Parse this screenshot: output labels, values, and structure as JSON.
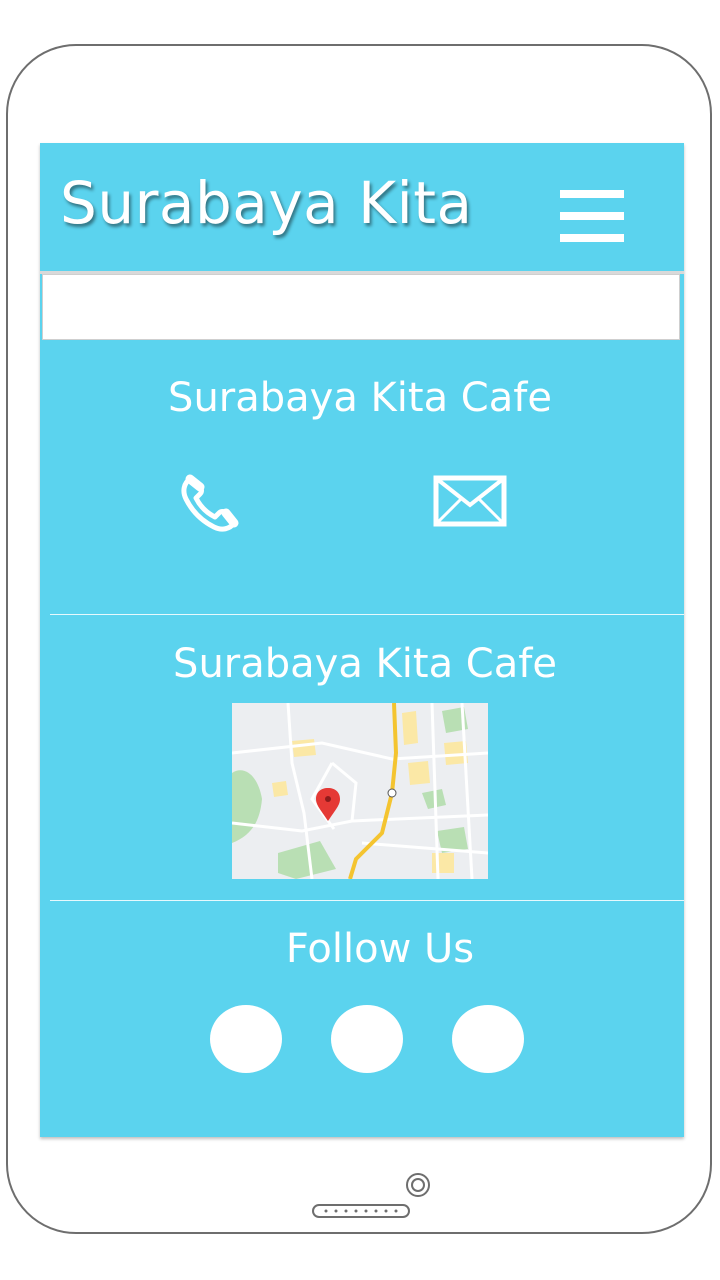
{
  "app": {
    "title": "Surabaya Kita"
  },
  "header": {
    "menu_icon": "hamburger-menu-icon"
  },
  "search": {
    "value": ""
  },
  "contact": {
    "title": "Surabaya Kita Cafe",
    "phone_icon": "phone-icon",
    "mail_icon": "mail-icon"
  },
  "location": {
    "title": "Surabaya Kita Cafe",
    "map_icon": "map-pin-icon"
  },
  "social": {
    "title": "Follow Us",
    "buttons": [
      "social-button",
      "social-button",
      "social-button"
    ]
  },
  "colors": {
    "accent": "#5bd3ee",
    "text": "#ffffff",
    "map_pin": "#e53935",
    "map_road": "#f4c430"
  }
}
